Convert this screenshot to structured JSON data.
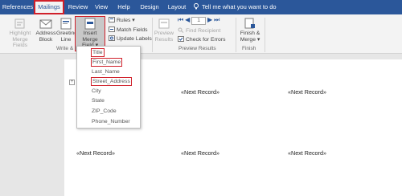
{
  "tabs": [
    "References",
    "Mailings",
    "Review",
    "View",
    "Help",
    "Design",
    "Layout"
  ],
  "tell_me": "Tell me what you want to do",
  "ribbon": {
    "highlight": [
      "Highlight",
      "Merge Fields"
    ],
    "address_block": [
      "Address",
      "Block"
    ],
    "greeting_line": [
      "Greeting",
      "Line"
    ],
    "insert_merge_field": [
      "Insert Merge",
      "Field"
    ],
    "rules": "Rules",
    "match_fields": "Match Fields",
    "update_labels": "Update Labels",
    "preview_results": [
      "Preview",
      "Results"
    ],
    "record_number": "1",
    "find_recipient": "Find Recipient",
    "check_errors": "Check for Errors",
    "finish_merge": [
      "Finish &",
      "Merge"
    ],
    "groups": {
      "write_insert": "Write & In",
      "preview": "Preview Results",
      "finish": "Finish"
    }
  },
  "dropdown": [
    "Title",
    "First_Name",
    "Last_Name",
    "Street_Address",
    "City",
    "State",
    "ZIP_Code",
    "Phone_Number"
  ],
  "document": {
    "row1": [
      "«Next Record»",
      "«Next Record»"
    ],
    "row2": [
      "«Next Record»",
      "«Next Record»",
      "«Next Record»"
    ]
  },
  "colors": {
    "accent": "#2b579a",
    "highlight": "#d0202a"
  }
}
